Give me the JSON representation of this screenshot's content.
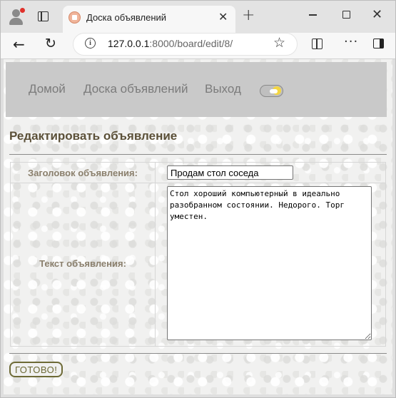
{
  "browser": {
    "tab_title": "Доска объявлений",
    "url_host": "127.0.0.1",
    "url_rest": ":8000/board/edit/8/"
  },
  "site_nav": {
    "home": "Домой",
    "board": "Доска объявлений",
    "logout": "Выход"
  },
  "page": {
    "title": "Редактировать объявление"
  },
  "form": {
    "title_label": "Заголовок объявления:",
    "title_value": "Продам стол соседа",
    "text_label": "Текст объявления:",
    "text_value": "Стол хороший компьютерный в идеально разобранном состоянии. Недорого. Торг уместен.",
    "submit_label": "ГОТОВО!"
  },
  "colors": {
    "header_bg": "#c9c9c9",
    "title_color": "#5b5038",
    "label_color": "#8a7f6c",
    "button_color": "#6d6a36"
  }
}
